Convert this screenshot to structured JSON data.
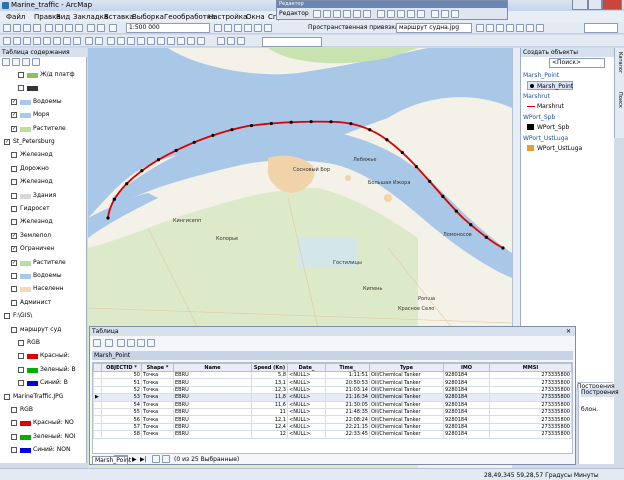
{
  "window": {
    "title": "Marine_traffic - ArcMap"
  },
  "menu": [
    "Файл",
    "Правка",
    "Вид",
    "Закладка",
    "Вставка",
    "Выборка",
    "Геообработка",
    "Настройка",
    "Окна",
    "Справка"
  ],
  "toolbar": {
    "scale": "1:500 000",
    "snapping": "Пространственная привязка",
    "raster_layer": "маршрут судна.jpg"
  },
  "editor": {
    "title": "Редактор",
    "label": "Редактор"
  },
  "toc": {
    "title": "Таблица содержания",
    "rows": [
      {
        "label": "Ж/д платф",
        "checked": false,
        "indent": 2,
        "swatch": "#8ec05a"
      },
      {
        "label": "",
        "checked": false,
        "indent": 2,
        "swatch": "#333333"
      },
      {
        "label": "Водоемы",
        "checked": true,
        "indent": 1,
        "swatch": "#a8c8f0"
      },
      {
        "label": "Моря",
        "checked": true,
        "indent": 1,
        "swatch": "#a8c8f0"
      },
      {
        "label": "Растителе",
        "checked": true,
        "indent": 1,
        "swatch": "#b8e09a"
      },
      {
        "label": "St_Petersburg",
        "checked": true,
        "indent": 0,
        "swatch": ""
      },
      {
        "label": "Железнод",
        "checked": false,
        "indent": 1,
        "swatch": ""
      },
      {
        "label": "Дорожно",
        "checked": false,
        "indent": 1,
        "swatch": ""
      },
      {
        "label": "Железнод",
        "checked": false,
        "indent": 1,
        "swatch": ""
      },
      {
        "label": "Здания",
        "checked": false,
        "indent": 1,
        "swatch": "#d8d8d8"
      },
      {
        "label": "Гидросет",
        "checked": false,
        "indent": 1,
        "swatch": ""
      },
      {
        "label": "Железнод",
        "checked": false,
        "indent": 1,
        "swatch": ""
      },
      {
        "label": "Землепол",
        "checked": true,
        "indent": 1,
        "swatch": ""
      },
      {
        "label": "Ограничен",
        "checked": true,
        "indent": 1,
        "swatch": ""
      },
      {
        "label": "Растителе",
        "checked": true,
        "indent": 1,
        "swatch": "#b8e09a"
      },
      {
        "label": "Водоемы",
        "checked": false,
        "indent": 1,
        "swatch": "#a8c8f0"
      },
      {
        "label": "Населенн",
        "checked": false,
        "indent": 1,
        "swatch": "#f0d8b8"
      },
      {
        "label": "Админист",
        "checked": false,
        "indent": 1,
        "swatch": ""
      },
      {
        "label": "F:\\GIS\\",
        "checked": false,
        "indent": 0,
        "swatch": ""
      },
      {
        "label": "маршрут суд",
        "checked": false,
        "indent": 1,
        "swatch": ""
      },
      {
        "label": "RGB",
        "checked": false,
        "indent": 2,
        "swatch": ""
      },
      {
        "label": "Красный:",
        "checked": false,
        "indent": 2,
        "swatch": "#e00000"
      },
      {
        "label": "Зеленый: B",
        "checked": false,
        "indent": 2,
        "swatch": "#00b000"
      },
      {
        "label": "Синий: B",
        "checked": false,
        "indent": 2,
        "swatch": "#0000e0"
      },
      {
        "label": "MarineTraffic.JPG",
        "checked": false,
        "indent": 0,
        "swatch": ""
      },
      {
        "label": "RGB",
        "checked": false,
        "indent": 1,
        "swatch": ""
      },
      {
        "label": "Красный: NO",
        "checked": false,
        "indent": 1,
        "swatch": "#e00000"
      },
      {
        "label": "Зеленый: NOI",
        "checked": false,
        "indent": 1,
        "swatch": "#00b000"
      },
      {
        "label": "Синий: NON",
        "checked": false,
        "indent": 1,
        "swatch": "#0000e0"
      }
    ]
  },
  "map": {
    "labels": [
      "Сосновый Бор",
      "Лебяжье",
      "Большая Ижора",
      "Ломоносов",
      "Кингисепп",
      "Копорье",
      "Гостилицы",
      "Кипень",
      "Ропша",
      "Красное Село"
    ]
  },
  "create": {
    "title": "Создать объекты",
    "search": "<Поиск>",
    "groups": [
      {
        "name": "Marsh_Point",
        "items": [
          "Marsh_Point"
        ]
      },
      {
        "name": "Marshrut",
        "items": [
          "Marshrut"
        ]
      },
      {
        "name": "WPort_Spb",
        "items": [
          "WPort_Spb"
        ]
      },
      {
        "name": "WPort_UstLuga",
        "items": [
          "WPort_UstLuga"
        ]
      }
    ],
    "sidetabs": [
      "Каталог",
      "Поиск"
    ],
    "props": "Построения",
    "props2": "блон."
  },
  "table": {
    "window_title": "Таблица",
    "name": "Marsh_Point",
    "headers": [
      "OBJECTID *",
      "Shape *",
      "Name",
      "Speed (Kn)",
      "Date_",
      "Time_",
      "Type",
      "IMO",
      "MMSI"
    ],
    "rows": [
      [
        "50",
        "Точка",
        "EBRU",
        "5,8",
        "<NULL>",
        "1:11:51",
        "Oil/Chemical Tanker",
        "9280184",
        "273335800"
      ],
      [
        "51",
        "Точка",
        "EBRU",
        "13,1",
        "<NULL>",
        "20:50:53",
        "Oil/Chemical Tanker",
        "9280184",
        "273335800"
      ],
      [
        "52",
        "Точка",
        "EBRU",
        "12,3",
        "<NULL>",
        "21:03:14",
        "Oil/Chemical Tanker",
        "9280184",
        "273335800"
      ],
      [
        "53",
        "Точка",
        "EBRU",
        "11,8",
        "<NULL>",
        "21:16:34",
        "Oil/Chemical Tanker",
        "9280184",
        "273335800"
      ],
      [
        "54",
        "Точка",
        "EBRU",
        "11,6",
        "<NULL>",
        "21:30:05",
        "Oil/Chemical Tanker",
        "9280184",
        "273335800"
      ],
      [
        "55",
        "Точка",
        "EBRU",
        "11",
        "<NULL>",
        "21:48:35",
        "Oil/Chemical Tanker",
        "9280184",
        "273335800"
      ],
      [
        "56",
        "Точка",
        "EBRU",
        "12,1",
        "<NULL>",
        "22:08:24",
        "Oil/Chemical Tanker",
        "9280184",
        "273335800"
      ],
      [
        "57",
        "Точка",
        "EBRU",
        "12,4",
        "<NULL>",
        "22:21:15",
        "Oil/Chemical Tanker",
        "9280184",
        "273335800"
      ],
      [
        "58",
        "Точка",
        "EBRU",
        "12",
        "<NULL>",
        "22:33:45",
        "Oil/Chemical Tanker",
        "9280184",
        "273335800"
      ]
    ],
    "footer": "(0 из 25 Выбранные)",
    "tab": "Marsh_Point"
  },
  "status": {
    "coords": "28,49,345  59,28,57  Градусы Минуты"
  },
  "colors": {
    "water": "#a9c7e6",
    "land": "#f3f1e8",
    "route": "#d80000",
    "veg": "#c9e3b0"
  }
}
